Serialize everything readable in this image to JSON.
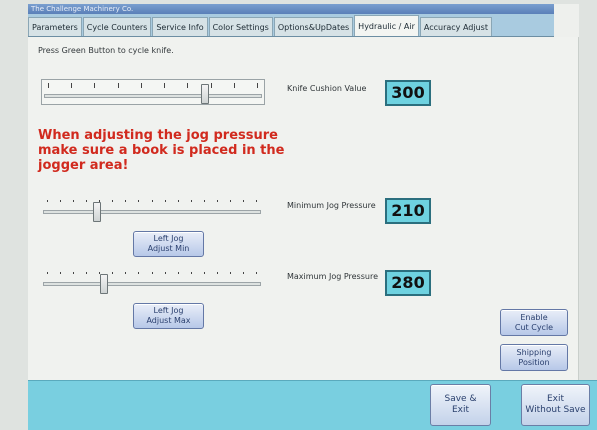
{
  "window": {
    "title": "The Challenge Machinery Co."
  },
  "tabs": [
    {
      "label": "Parameters"
    },
    {
      "label": "Cycle Counters"
    },
    {
      "label": "Service Info"
    },
    {
      "label": "Color Settings"
    },
    {
      "label": "Options&UpDates"
    },
    {
      "label": "Hydraulic / Air"
    },
    {
      "label": "Accuracy Adjust"
    }
  ],
  "active_tab": "Hydraulic / Air",
  "instruction": "Press Green Button to cycle knife.",
  "warning": "When adjusting the jog pressure make sure a book is placed in the jogger area!",
  "knife_cushion": {
    "label": "Knife Cushion Value",
    "value": "300",
    "slider_fraction": 0.75
  },
  "min_jog": {
    "label": "Minimum Jog Pressure",
    "value": "210",
    "slider_fraction": 0.23,
    "button": "Left Jog\nAdjust Min"
  },
  "max_jog": {
    "label": "Maximum Jog Pressure",
    "value": "280",
    "slider_fraction": 0.26,
    "button": "Left Jog\nAdjust Max"
  },
  "side_buttons": {
    "enable_cycle": "Enable\nCut Cycle",
    "shipping": "Shipping\nPosition"
  },
  "footer": {
    "save_exit": "Save &\nExit",
    "exit_without_save": "Exit\nWithout Save"
  },
  "colors": {
    "value_box": "#6ed2e0",
    "warning": "#d12a1e",
    "tab_bar": "#a9cbe0",
    "footer": "#79cfe0"
  }
}
